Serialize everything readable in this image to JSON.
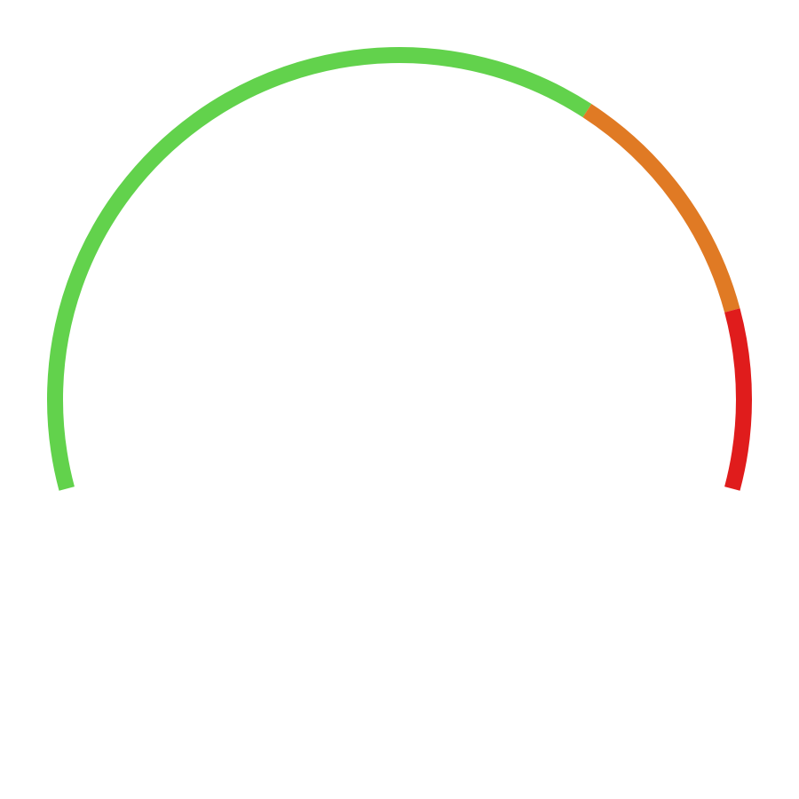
{
  "chart_data": {
    "type": "gauge",
    "start_angle_deg": 195,
    "end_angle_deg": -15,
    "segments": [
      {
        "name": "",
        "from_deg": 195,
        "to_deg": 57,
        "color": "#62d24c"
      },
      {
        "name": "",
        "from_deg": 57,
        "to_deg": 15,
        "color": "#e07a24"
      },
      {
        "name": "",
        "from_deg": 15,
        "to_deg": -15,
        "color": "#e01c1c"
      }
    ],
    "value": null,
    "title": ""
  }
}
